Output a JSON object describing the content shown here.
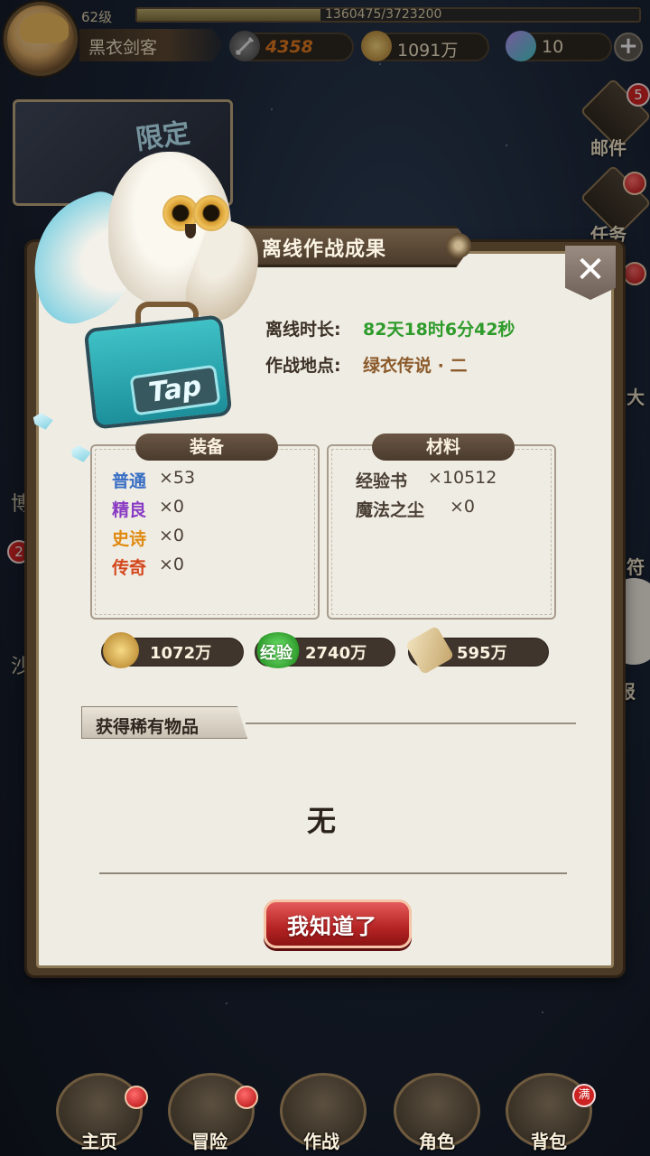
{
  "top": {
    "level": "62级",
    "exp_fraction": 0.365,
    "exp_text": "1360475/3723200",
    "player_name": "黑衣剑客",
    "power": "4358",
    "gold": "1091万",
    "gems": "10",
    "plus_label": "+"
  },
  "left_side": {
    "promo_label": "限定",
    "badge_count": "2",
    "partial_texts": [
      "博",
      "沙"
    ]
  },
  "right_side": {
    "mail_label": "邮件",
    "mail_badge": "5",
    "task_label": "任务",
    "partial_texts": [
      "大",
      "符",
      "报"
    ]
  },
  "dialog": {
    "title": "离线作战成果",
    "close_label": "✕",
    "duration_label": "离线时长:",
    "duration_value": "82天18时6分42秒",
    "location_label": "作战地点:",
    "location_value": "绿衣传说 · 二",
    "equipment": {
      "header": "装备",
      "items": [
        {
          "name": "普通",
          "count": "×53",
          "color": "#3a6fc4"
        },
        {
          "name": "精良",
          "count": "×0",
          "color": "#8a3bc4"
        },
        {
          "name": "史诗",
          "count": "×0",
          "color": "#e08a12"
        },
        {
          "name": "传奇",
          "count": "×0",
          "color": "#d4461c"
        }
      ]
    },
    "materials": {
      "header": "材料",
      "items": [
        {
          "name": "经验书",
          "count": "×10512"
        },
        {
          "name": "魔法之尘",
          "count": "×0"
        }
      ]
    },
    "rewards": {
      "gold": "1072万",
      "exp_label": "经验",
      "exp": "2740万",
      "scroll": "595万"
    },
    "rare_items_title": "获得稀有物品",
    "rare_items_value": "无",
    "confirm_button": "我知道了"
  },
  "mascot": {
    "logo": "Tap"
  },
  "bottom_nav": [
    {
      "label": "主页"
    },
    {
      "label": "冒险"
    },
    {
      "label": "作战"
    },
    {
      "label": "角色"
    },
    {
      "label": "背包",
      "badge": "满"
    }
  ]
}
